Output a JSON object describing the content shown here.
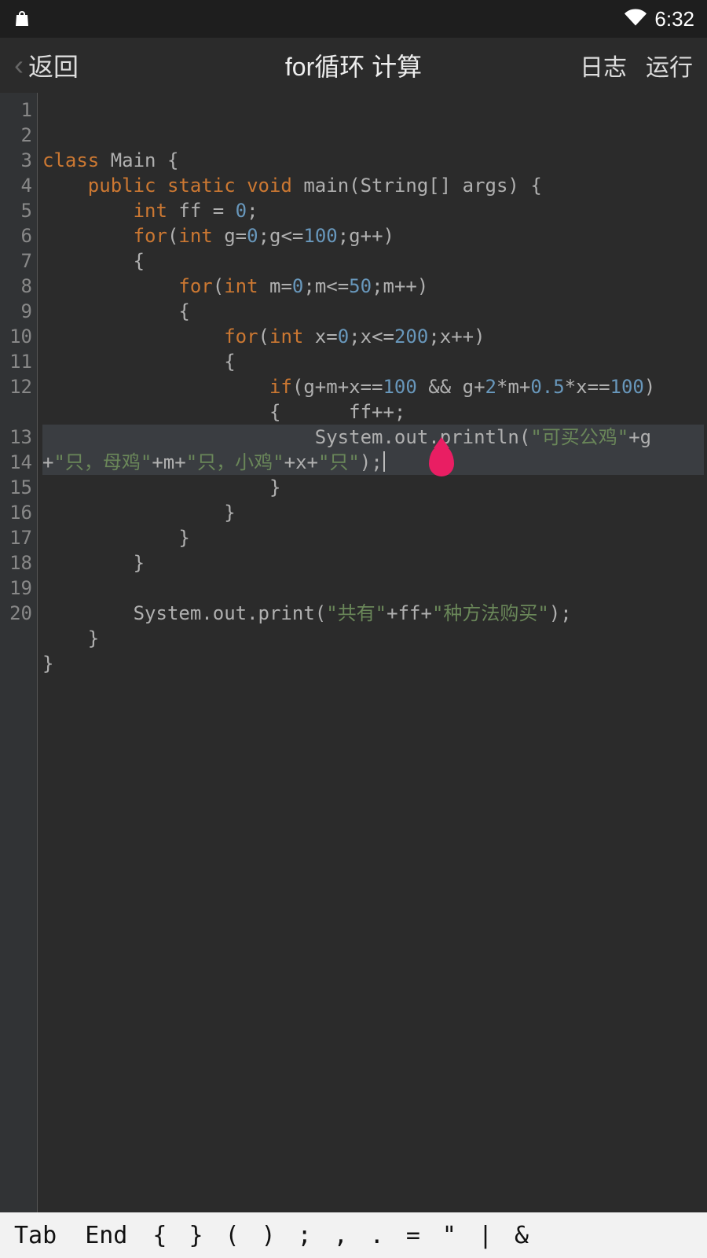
{
  "status_bar": {
    "time": "6:32"
  },
  "header": {
    "back_label": "返回",
    "title": "for循环 计算",
    "log_label": "日志",
    "run_label": "运行"
  },
  "editor": {
    "line_count": 20,
    "highlighted_line": 12,
    "cursor_after_line": 12
  },
  "code": {
    "tokens": [
      [
        {
          "t": "kw",
          "v": "class"
        },
        {
          "t": "pn",
          "v": " Main {"
        }
      ],
      [
        {
          "t": "pn",
          "v": "    "
        },
        {
          "t": "kw",
          "v": "public static void"
        },
        {
          "t": "pn",
          "v": " main(String[] args) {"
        }
      ],
      [
        {
          "t": "pn",
          "v": "        "
        },
        {
          "t": "kw",
          "v": "int"
        },
        {
          "t": "pn",
          "v": " ff = "
        },
        {
          "t": "num",
          "v": "0"
        },
        {
          "t": "pn",
          "v": ";"
        }
      ],
      [
        {
          "t": "pn",
          "v": "        "
        },
        {
          "t": "kw",
          "v": "for"
        },
        {
          "t": "pn",
          "v": "("
        },
        {
          "t": "kw",
          "v": "int"
        },
        {
          "t": "pn",
          "v": " g="
        },
        {
          "t": "num",
          "v": "0"
        },
        {
          "t": "pn",
          "v": ";g<="
        },
        {
          "t": "num",
          "v": "100"
        },
        {
          "t": "pn",
          "v": ";g++)"
        }
      ],
      [
        {
          "t": "pn",
          "v": "        {"
        }
      ],
      [
        {
          "t": "pn",
          "v": "            "
        },
        {
          "t": "kw",
          "v": "for"
        },
        {
          "t": "pn",
          "v": "("
        },
        {
          "t": "kw",
          "v": "int"
        },
        {
          "t": "pn",
          "v": " m="
        },
        {
          "t": "num",
          "v": "0"
        },
        {
          "t": "pn",
          "v": ";m<="
        },
        {
          "t": "num",
          "v": "50"
        },
        {
          "t": "pn",
          "v": ";m++)"
        }
      ],
      [
        {
          "t": "pn",
          "v": "            {"
        }
      ],
      [
        {
          "t": "pn",
          "v": "                "
        },
        {
          "t": "kw",
          "v": "for"
        },
        {
          "t": "pn",
          "v": "("
        },
        {
          "t": "kw",
          "v": "int"
        },
        {
          "t": "pn",
          "v": " x="
        },
        {
          "t": "num",
          "v": "0"
        },
        {
          "t": "pn",
          "v": ";x<="
        },
        {
          "t": "num",
          "v": "200"
        },
        {
          "t": "pn",
          "v": ";x++)"
        }
      ],
      [
        {
          "t": "pn",
          "v": "                {"
        }
      ],
      [
        {
          "t": "pn",
          "v": "                    "
        },
        {
          "t": "kw",
          "v": "if"
        },
        {
          "t": "pn",
          "v": "(g+m+x=="
        },
        {
          "t": "num",
          "v": "100"
        },
        {
          "t": "pn",
          "v": " && g+"
        },
        {
          "t": "num",
          "v": "2"
        },
        {
          "t": "pn",
          "v": "*m+"
        },
        {
          "t": "num",
          "v": "0.5"
        },
        {
          "t": "pn",
          "v": "*x=="
        },
        {
          "t": "num",
          "v": "100"
        },
        {
          "t": "pn",
          "v": ")"
        }
      ],
      [
        {
          "t": "pn",
          "v": "                    {      ff++;"
        }
      ],
      [
        {
          "t": "pn",
          "v": "                        System.out.println("
        },
        {
          "t": "str",
          "v": "\"可买公鸡\""
        },
        {
          "t": "pn",
          "v": "+g+"
        },
        {
          "t": "str",
          "v": "\"只，母鸡\""
        },
        {
          "t": "pn",
          "v": "+m+"
        },
        {
          "t": "str",
          "v": "\"只，小鸡\""
        },
        {
          "t": "pn",
          "v": "+x+"
        },
        {
          "t": "str",
          "v": "\"只\""
        },
        {
          "t": "pn",
          "v": ");"
        }
      ],
      [
        {
          "t": "pn",
          "v": "                    }"
        }
      ],
      [
        {
          "t": "pn",
          "v": "                }"
        }
      ],
      [
        {
          "t": "pn",
          "v": "            }"
        }
      ],
      [
        {
          "t": "pn",
          "v": "        }"
        }
      ],
      [
        {
          "t": "pn",
          "v": ""
        }
      ],
      [
        {
          "t": "pn",
          "v": "        System.out.print("
        },
        {
          "t": "str",
          "v": "\"共有\""
        },
        {
          "t": "pn",
          "v": "+ff+"
        },
        {
          "t": "str",
          "v": "\"种方法购买\""
        },
        {
          "t": "pn",
          "v": ");"
        }
      ],
      [
        {
          "t": "pn",
          "v": "    }"
        }
      ],
      [
        {
          "t": "pn",
          "v": "}"
        }
      ]
    ]
  },
  "key_row": {
    "keys": [
      "Tab",
      "End",
      "{",
      "}",
      "(",
      ")",
      ";",
      ",",
      ".",
      "=",
      "\"",
      "|",
      "&"
    ]
  }
}
